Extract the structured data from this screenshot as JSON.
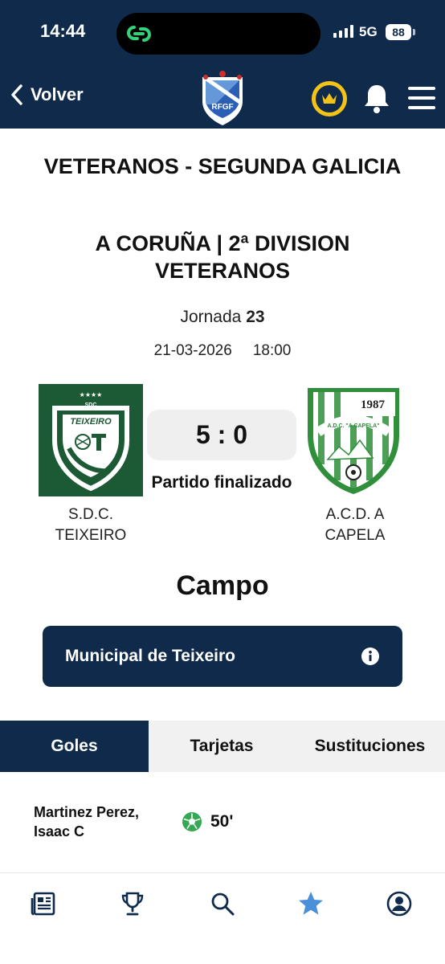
{
  "status_bar": {
    "time": "14:44",
    "network": "5G",
    "battery": "88"
  },
  "header": {
    "back_label": "Volver",
    "logo_text": "RFGF"
  },
  "competition": {
    "title": "VETERANOS - SEGUNDA GALICIA",
    "group": "A CORUÑA | 2ª DIVISION VETERANOS"
  },
  "round": {
    "label": "Jornada",
    "number": "23"
  },
  "match": {
    "date": "21-03-2026",
    "time": "18:00",
    "score": "5 : 0",
    "status": "Partido finalizado",
    "home": {
      "name": "S.D.C. TEIXEIRO",
      "crest_text": "TEIXEIRO",
      "crest_top": "SDC"
    },
    "away": {
      "name": "A.C.D. A CAPELA",
      "crest_text": "A.D.C. \"A CAPELA\"",
      "crest_year": "1987"
    }
  },
  "venue": {
    "section_title": "Campo",
    "name": "Municipal de Teixeiro"
  },
  "tabs": [
    {
      "label": "Goles",
      "active": true
    },
    {
      "label": "Tarjetas",
      "active": false
    },
    {
      "label": "Sustituciones",
      "active": false
    }
  ],
  "goals": [
    {
      "player": "Martinez Perez, Isaac C",
      "minute": "50'"
    }
  ],
  "bottom_nav": [
    {
      "icon": "news-icon"
    },
    {
      "icon": "trophy-icon"
    },
    {
      "icon": "search-icon"
    },
    {
      "icon": "star-icon",
      "active": true
    },
    {
      "icon": "profile-icon"
    }
  ],
  "colors": {
    "primary": "#0f2a4a",
    "accent_gold": "#f3c318",
    "active_nav": "#4a90d9",
    "goal_green": "#34a853"
  }
}
